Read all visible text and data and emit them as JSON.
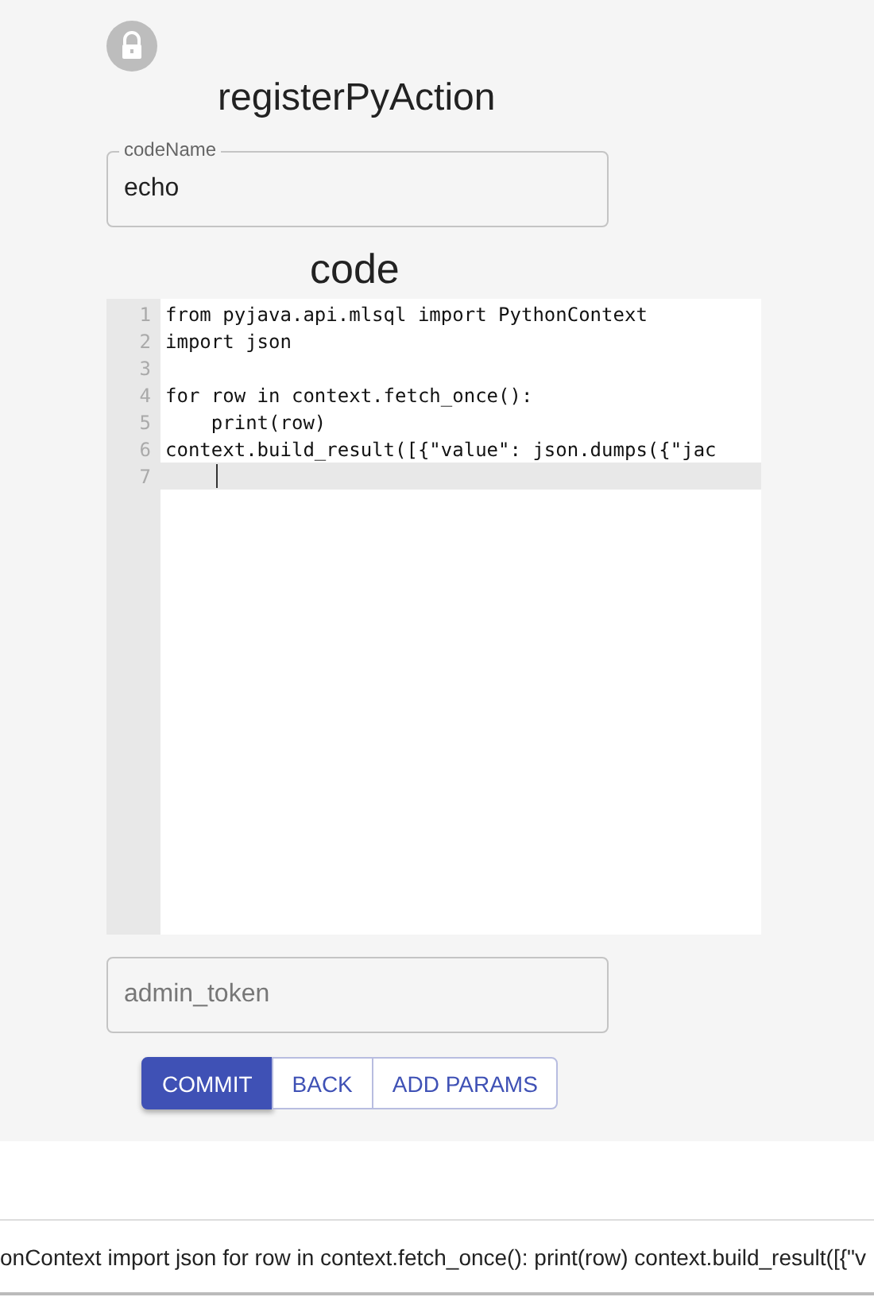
{
  "title": "registerPyAction",
  "code_name_field": {
    "label": "codeName",
    "value": "echo"
  },
  "code_heading": "code",
  "editor": {
    "lines": [
      {
        "number": "1",
        "text": "from pyjava.api.mlsql import PythonContext",
        "active": false
      },
      {
        "number": "2",
        "text": "import json",
        "active": false
      },
      {
        "number": "3",
        "active": false
      },
      {
        "number": "4",
        "text": "for row in context.fetch_once():",
        "active": false
      },
      {
        "number": "5",
        "text": "    print(row)",
        "active": false
      },
      {
        "number": "6",
        "text": "context.build_result([{\"value\": json.dumps({\"jac",
        "active": false
      },
      {
        "number": "7",
        "active": true
      }
    ]
  },
  "token_field": {
    "placeholder": "admin_token"
  },
  "buttons": [
    {
      "label": "COMMIT",
      "selected": true
    },
    {
      "label": "BACK",
      "selected": false
    },
    {
      "label": "ADD PARAMS",
      "selected": false
    }
  ],
  "output_text": "onContext import json for row in context.fetch_once(): print(row) context.build_result([{\"v"
}
